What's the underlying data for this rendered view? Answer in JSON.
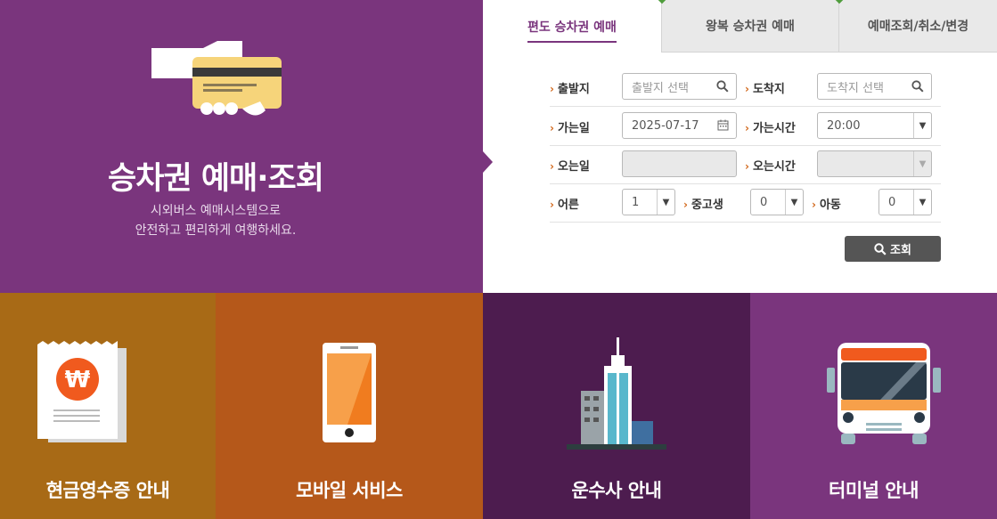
{
  "hero": {
    "title": "승차권 예매·조회",
    "subtitle_line1": "시외버스 예매시스템으로",
    "subtitle_line2": "안전하고 편리하게 여행하세요.",
    "icon": "ticket-card-icon"
  },
  "tabs": [
    {
      "label": "편도 승차권 예매",
      "active": true
    },
    {
      "label": "왕복 승차권 예매",
      "active": false
    },
    {
      "label": "예매조회/취소/변경",
      "active": false
    }
  ],
  "form": {
    "departure_label": "출발지",
    "departure_placeholder": "출발지 선택",
    "arrival_label": "도착지",
    "arrival_placeholder": "도착지 선택",
    "go_date_label": "가는일",
    "go_date_value": "2025-07-17",
    "go_time_label": "가는시간",
    "go_time_value": "20:00",
    "return_date_label": "오는일",
    "return_date_value": "",
    "return_time_label": "오는시간",
    "return_time_value": "",
    "adult_label": "어른",
    "adult_value": "1",
    "youth_label": "중고생",
    "youth_value": "0",
    "child_label": "아동",
    "child_value": "0",
    "search_button": "조회"
  },
  "tiles": [
    {
      "label": "현금영수증 안내",
      "icon": "receipt-icon",
      "color": "#a86a16"
    },
    {
      "label": "모바일 서비스",
      "icon": "smartphone-icon",
      "color": "#b5581a"
    },
    {
      "label": "운수사 안내",
      "icon": "building-icon",
      "color": "#4d1c4f"
    },
    {
      "label": "터미널 안내",
      "icon": "bus-icon",
      "color": "#7a357d"
    }
  ],
  "colors": {
    "brand_purple": "#7a357d",
    "accent_orange": "#d2691e",
    "dark_button": "#555555"
  }
}
